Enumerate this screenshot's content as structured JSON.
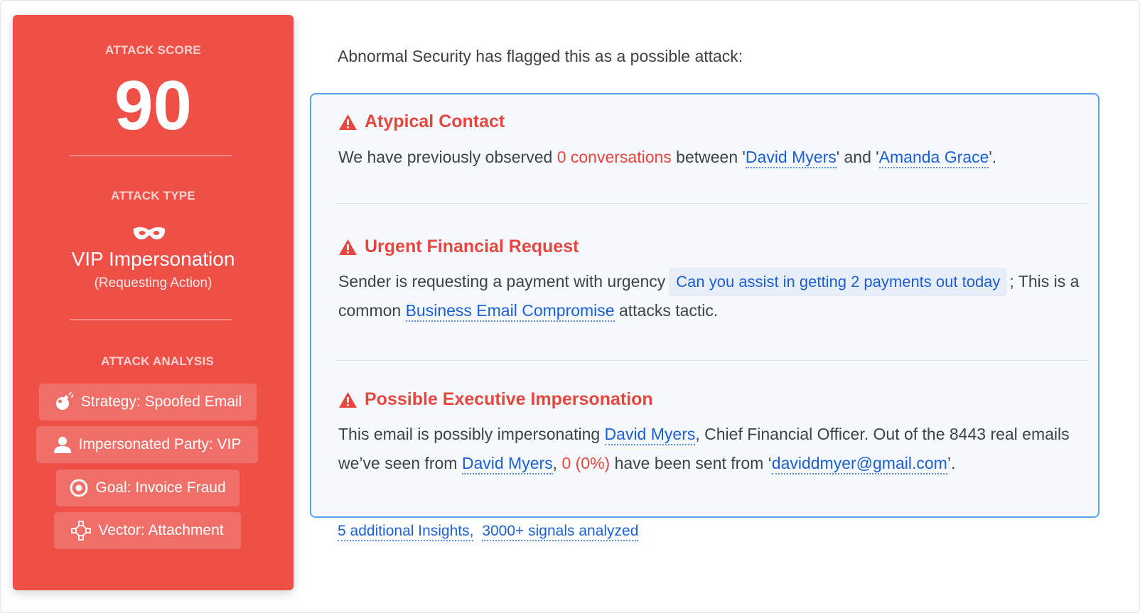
{
  "panel": {
    "score_label": "ATTACK SCORE",
    "score": "90",
    "type_label": "ATTACK TYPE",
    "type_icon": "mask-icon",
    "type_title": "VIP Impersonation",
    "type_subtitle": "(Requesting Action)",
    "analysis_label": "ATTACK ANALYSIS",
    "chips": [
      {
        "icon": "bomb-icon",
        "label": "Strategy: Spoofed Email"
      },
      {
        "icon": "person-icon",
        "label": "Impersonated Party: VIP"
      },
      {
        "icon": "target-icon",
        "label": "Goal: Invoice Fraud"
      },
      {
        "icon": "vector-icon",
        "label": "Vector: Attachment"
      }
    ]
  },
  "intro": "Abnormal Security has flagged this as a possible attack:",
  "insights": [
    {
      "title": "Atypical Contact",
      "parts": {
        "t1": "We have previously observed ",
        "count": "0 conversations",
        "t2": " between '",
        "person1": "David Myers",
        "t3": "' and '",
        "person2": "Amanda Grace",
        "t4": "'."
      }
    },
    {
      "title": "Urgent Financial Request",
      "parts": {
        "t1": "Sender is requesting a payment with urgency",
        "quote": "Can you assist in getting 2 payments out today",
        "t2": "; This is a common ",
        "link": "Business Email Compromise",
        "t3": " attacks tactic."
      }
    },
    {
      "title": "Possible Executive Impersonation",
      "parts": {
        "t1": "This email is possibly impersonating ",
        "person1": "David Myers",
        "t2": ", Chief Financial Officer. Out of the 8443 real emails we’ve seen from ",
        "person2": "David Myers",
        "t3": ", ",
        "count": "0 (0%)",
        "t4": " have been sent from ‘",
        "email": "daviddmyer@gmail.com",
        "t5": "’."
      }
    }
  ],
  "footer": {
    "insights_link": "5 additional Insights,",
    "signals_link": "3000+ signals analyzed"
  },
  "colors": {
    "panel_bg": "#ee5048",
    "alert_red": "#e7463f",
    "link_blue": "#1b5fd6",
    "card_border": "#5aa0ee"
  }
}
